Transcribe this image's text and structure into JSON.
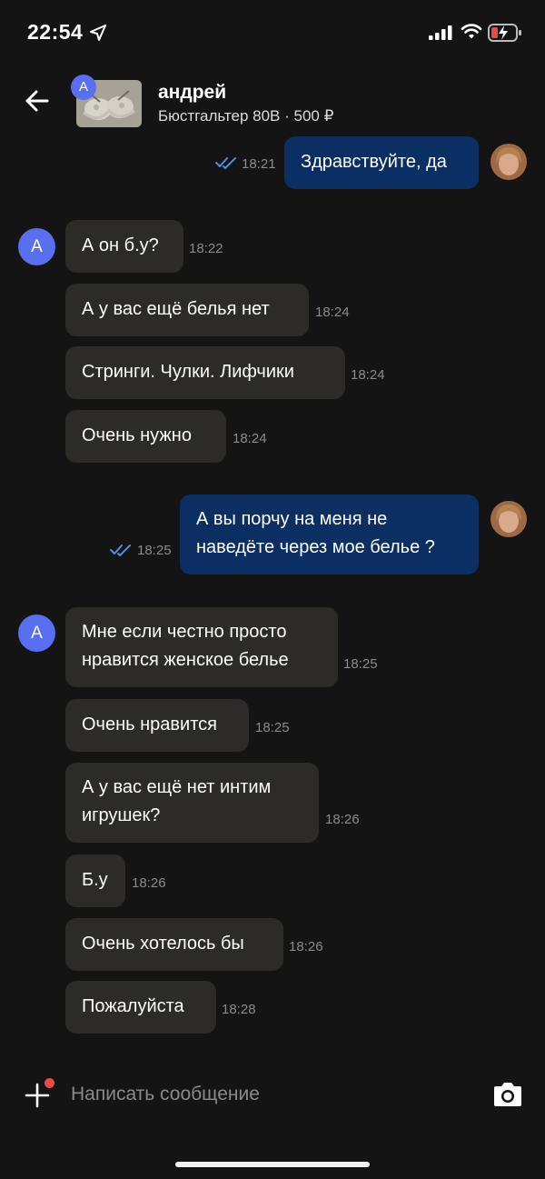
{
  "status_bar": {
    "time": "22:54"
  },
  "header": {
    "name": "андрей",
    "subtitle": "Бюстгальтер 80В · 500 ₽",
    "badge_letter": "А"
  },
  "contact_initial": "А",
  "messages": [
    {
      "text": "Здравствуйте, да",
      "time": "18:21"
    },
    {
      "text": "А он б.у?",
      "time": "18:22"
    },
    {
      "text": "А у вас ещё белья нет",
      "time": "18:24"
    },
    {
      "text": "Стринги. Чулки. Лифчики",
      "time": "18:24"
    },
    {
      "text": "Очень нужно",
      "time": "18:24"
    },
    {
      "line1": "А вы порчу на меня не",
      "line2": "наведёте через мое белье ?",
      "time": "18:25"
    },
    {
      "line1": "Мне если честно просто",
      "line2": "нравится женское белье",
      "time": "18:25"
    },
    {
      "text": "Очень нравится",
      "time": "18:25"
    },
    {
      "line1": "А у вас ещё нет интим",
      "line2": "игрушек?",
      "time": "18:26"
    },
    {
      "text": "Б.у",
      "time": "18:26"
    },
    {
      "text": "Очень хотелось бы",
      "time": "18:26"
    },
    {
      "text": "Пожалуйста",
      "time": "18:28"
    }
  ],
  "composer": {
    "placeholder": "Написать сообщение"
  },
  "colors": {
    "background": "#141414",
    "incoming_bubble": "#2d2b28",
    "outgoing_bubble": "#0c2f63",
    "avatar": "#5a6ef0",
    "read_check": "#4a8fe8",
    "notification_dot": "#e74b4b"
  }
}
